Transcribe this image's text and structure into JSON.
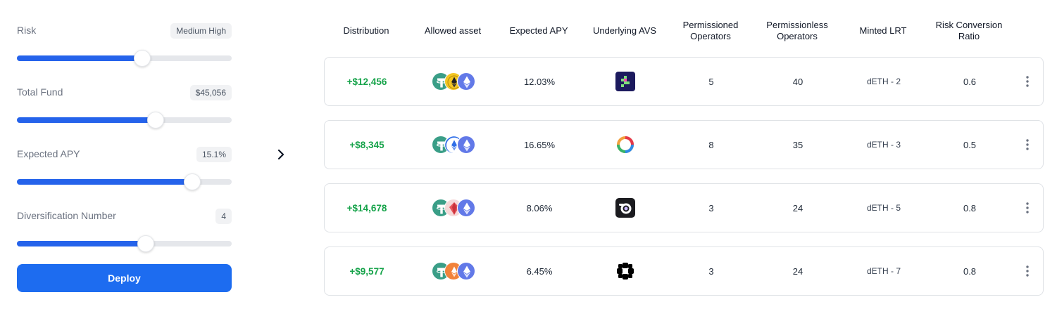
{
  "controls": [
    {
      "label": "Risk",
      "badge": "Medium High",
      "level_percent": 58.5
    },
    {
      "label": "Total Fund",
      "badge": "$45,056",
      "level_percent": 64.5
    },
    {
      "label": "Expected APY",
      "badge": "15.1%",
      "level_percent": 81.5
    },
    {
      "label": "Diversification Number",
      "badge": "4",
      "level_percent": 60
    }
  ],
  "deploy_label": "Deploy",
  "headers": [
    "Distribution",
    "Allowed asset",
    "Expected APY",
    "Underlying AVS",
    "Permissioned\nOperators",
    "Permissionless\nOperators",
    "Minted LRT",
    "Risk Conversion\nRatio"
  ],
  "rows": [
    {
      "distribution": "+$12,456",
      "apy": "12.03%",
      "permissioned": "5",
      "permissionless": "40",
      "minted": "dETH - 2",
      "ratio": "0.6",
      "middle_coin_icon": "eth-gold-icon",
      "avs_icon": "pixel-avs-icon"
    },
    {
      "distribution": "+$8,345",
      "apy": "16.65%",
      "permissioned": "8",
      "permissionless": "35",
      "minted": "dETH - 3",
      "ratio": "0.5",
      "middle_coin_icon": "eth-outline-icon",
      "avs_icon": "ring-avs-icon"
    },
    {
      "distribution": "+$14,678",
      "apy": "8.06%",
      "permissioned": "3",
      "permissionless": "24",
      "minted": "dETH - 5",
      "ratio": "0.8",
      "middle_coin_icon": "red-crystal-icon",
      "avs_icon": "lens-avs-icon"
    },
    {
      "distribution": "+$9,577",
      "apy": "6.45%",
      "permissioned": "3",
      "permissionless": "24",
      "minted": "dETH - 7",
      "ratio": "0.8",
      "middle_coin_icon": "eth-orange-icon",
      "avs_icon": "flower-avs-icon"
    }
  ],
  "colors": {
    "accent": "#2563eb",
    "positive": "#16a34a",
    "tether": "#3a9e87",
    "eth_blue": "#6279e8"
  }
}
